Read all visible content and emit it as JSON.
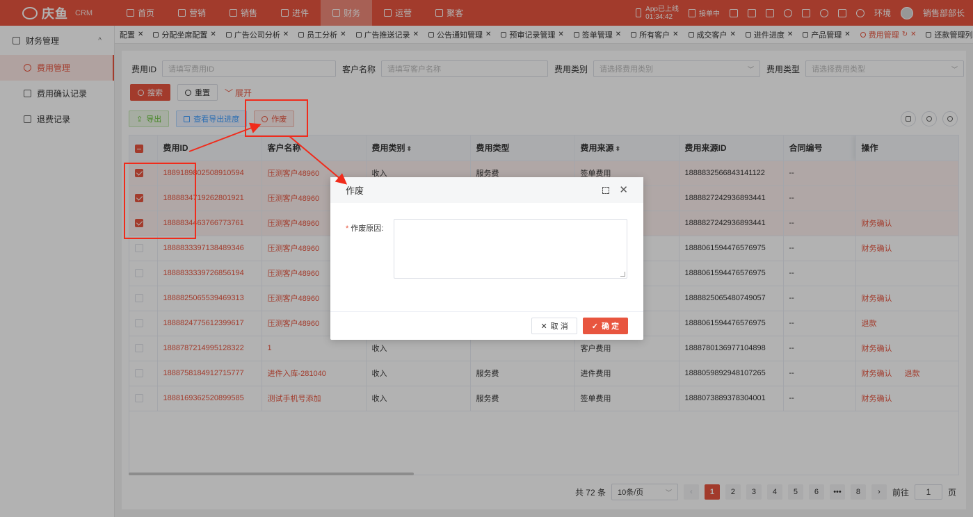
{
  "topnav": {
    "logo_text": "庆鱼",
    "logo_sub": "CRM",
    "items": [
      {
        "label": "首页",
        "icon": "home-icon"
      },
      {
        "label": "营销",
        "icon": "marketing-icon"
      },
      {
        "label": "销售",
        "icon": "sales-icon"
      },
      {
        "label": "进件",
        "icon": "intake-icon"
      },
      {
        "label": "财务",
        "icon": "finance-icon",
        "active": true
      },
      {
        "label": "运营",
        "icon": "operations-icon"
      },
      {
        "label": "聚客",
        "icon": "customers-icon"
      }
    ],
    "app_upload_label": "App已上线",
    "app_upload_time": "01:34:42",
    "signing_label": "接单中",
    "env_label": "环境",
    "user_name": "销售部部长"
  },
  "sidebar": {
    "group_label": "财务管理",
    "items": [
      {
        "label": "费用管理",
        "active": true
      },
      {
        "label": "费用确认记录"
      },
      {
        "label": "退费记录"
      }
    ]
  },
  "tabs": [
    {
      "label": "配置"
    },
    {
      "label": "分配坐席配置"
    },
    {
      "label": "广告公司分析"
    },
    {
      "label": "员工分析"
    },
    {
      "label": "广告推送记录"
    },
    {
      "label": "公告通知管理"
    },
    {
      "label": "预审记录管理"
    },
    {
      "label": "签单管理"
    },
    {
      "label": "所有客户"
    },
    {
      "label": "成交客户"
    },
    {
      "label": "进件进度"
    },
    {
      "label": "产品管理"
    },
    {
      "label": "费用管理",
      "active": true
    },
    {
      "label": "还款管理列表"
    }
  ],
  "filters": {
    "fee_id_label": "费用ID",
    "fee_id_placeholder": "请填写费用ID",
    "customer_label": "客户名称",
    "customer_placeholder": "请填写客户名称",
    "fee_category_label": "费用类别",
    "fee_category_placeholder": "请选择费用类别",
    "fee_type_label": "费用类型",
    "fee_type_placeholder": "请选择费用类型"
  },
  "buttons": {
    "search": "搜索",
    "reset": "重置",
    "expand": "展开",
    "export": "导出",
    "view_export": "查看导出进度",
    "void": "作废"
  },
  "table": {
    "columns": [
      "费用ID",
      "客户名称",
      "费用类别",
      "费用类型",
      "费用来源",
      "费用来源ID",
      "合同编号",
      "操作"
    ],
    "rows": [
      {
        "id": "1889189802508910594",
        "customer": "压测客户48960",
        "category": "收入",
        "type": "服务费",
        "source": "签单费用",
        "source_id": "1888832566843141122",
        "contract": "--",
        "ops": [],
        "checked": true
      },
      {
        "id": "1888834719262801921",
        "customer": "压测客户48960",
        "category": "",
        "type": "",
        "source": "",
        "source_id": "1888827242936893441",
        "contract": "--",
        "ops": [],
        "checked": true
      },
      {
        "id": "1888834463766773761",
        "customer": "压测客户48960",
        "category": "",
        "type": "",
        "source": "",
        "source_id": "1888827242936893441",
        "contract": "--",
        "ops": [
          "财务确认"
        ],
        "checked": true
      },
      {
        "id": "1888833397138489346",
        "customer": "压测客户48960",
        "category": "",
        "type": "",
        "source": "",
        "source_id": "1888061594476576975",
        "contract": "--",
        "ops": [
          "财务确认"
        ],
        "checked": false
      },
      {
        "id": "1888833339726856194",
        "customer": "压测客户48960",
        "category": "",
        "type": "",
        "source": "",
        "source_id": "1888061594476576975",
        "contract": "--",
        "ops": [],
        "checked": false
      },
      {
        "id": "1888825065539469313",
        "customer": "压测客户48960",
        "category": "",
        "type": "",
        "source": "",
        "source_id": "1888825065480749057",
        "contract": "--",
        "ops": [
          "财务确认"
        ],
        "checked": false
      },
      {
        "id": "1888824775612399617",
        "customer": "压测客户48960",
        "category": "",
        "type": "",
        "source": "",
        "source_id": "1888061594476576975",
        "contract": "--",
        "ops": [
          "退款"
        ],
        "checked": false
      },
      {
        "id": "1888787214995128322",
        "customer": "1",
        "category": "收入",
        "type": "",
        "source": "客户费用",
        "source_id": "1888780136977104898",
        "contract": "--",
        "ops": [
          "财务确认"
        ],
        "checked": false
      },
      {
        "id": "1888758184912715777",
        "customer": "进件入库-281040",
        "category": "收入",
        "type": "服务费",
        "source": "进件费用",
        "source_id": "1888059892948107265",
        "contract": "--",
        "ops": [
          "财务确认",
          "退款"
        ],
        "checked": false
      },
      {
        "id": "1888169362520899585",
        "customer": "测试手机号添加",
        "category": "收入",
        "type": "服务费",
        "source": "签单费用",
        "source_id": "1888073889378304001",
        "contract": "--",
        "ops": [
          "财务确认"
        ],
        "checked": false
      }
    ]
  },
  "pagination": {
    "total_text": "共 72 条",
    "page_size": "10条/页",
    "pages": [
      "1",
      "2",
      "3",
      "4",
      "5",
      "6",
      "•••",
      "8"
    ],
    "current": "1",
    "goto_label": "前往",
    "goto_value": "1",
    "page_suffix": "页"
  },
  "modal": {
    "title": "作废",
    "reason_label": "作废原因:",
    "cancel": "取 消",
    "confirm": "确 定"
  },
  "colors": {
    "brand": "#e8553f",
    "annotation": "#f02b1b"
  }
}
